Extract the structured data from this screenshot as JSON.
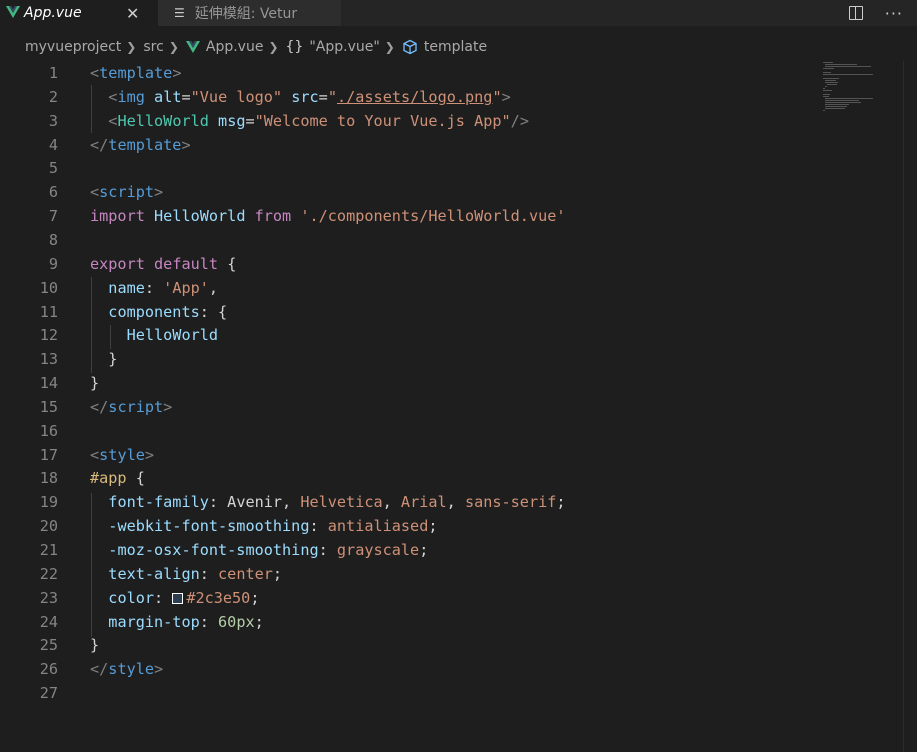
{
  "tabs": {
    "active": {
      "label": "App.vue",
      "close": "✕"
    },
    "inactive": {
      "label": "延伸模組: Vetur"
    }
  },
  "breadcrumb": {
    "items": [
      "myvueproject",
      "src",
      "App.vue",
      "\"App.vue\"",
      "template"
    ],
    "braces": "{}"
  },
  "actions": {
    "more": "···"
  },
  "colors": {
    "vue_green": "#41b883",
    "vue_dark": "#34495e",
    "swatch": "#2c3e50"
  },
  "editor": {
    "lines": [
      {
        "n": "1",
        "tokens": [
          [
            "t-tag",
            "<"
          ],
          [
            "t-tagname",
            "template"
          ],
          [
            "t-tag",
            ">"
          ]
        ]
      },
      {
        "n": "2",
        "tokens": [
          [
            "t-plain",
            "  "
          ],
          [
            "t-tag",
            "<"
          ],
          [
            "t-tagname",
            "img"
          ],
          [
            "t-plain",
            " "
          ],
          [
            "t-attr",
            "alt"
          ],
          [
            "t-plain",
            "="
          ],
          [
            "t-str",
            "\"Vue logo\""
          ],
          [
            "t-plain",
            " "
          ],
          [
            "t-attr",
            "src"
          ],
          [
            "t-plain",
            "="
          ],
          [
            "t-str",
            "\""
          ],
          [
            "t-str t-link",
            "./assets/logo.png"
          ],
          [
            "t-str",
            "\""
          ],
          [
            "t-tag",
            ">"
          ]
        ]
      },
      {
        "n": "3",
        "tokens": [
          [
            "t-plain",
            "  "
          ],
          [
            "t-tag",
            "<"
          ],
          [
            "t-comp",
            "HelloWorld"
          ],
          [
            "t-plain",
            " "
          ],
          [
            "t-attr",
            "msg"
          ],
          [
            "t-plain",
            "="
          ],
          [
            "t-str",
            "\"Welcome to Your Vue.js App\""
          ],
          [
            "t-tag",
            "/>"
          ]
        ]
      },
      {
        "n": "4",
        "tokens": [
          [
            "t-tag",
            "</"
          ],
          [
            "t-tagname",
            "template"
          ],
          [
            "t-tag",
            ">"
          ]
        ]
      },
      {
        "n": "5",
        "tokens": []
      },
      {
        "n": "6",
        "tokens": [
          [
            "t-tag",
            "<"
          ],
          [
            "t-tagname",
            "script"
          ],
          [
            "t-tag",
            ">"
          ]
        ]
      },
      {
        "n": "7",
        "tokens": [
          [
            "t-kw",
            "import"
          ],
          [
            "t-plain",
            " "
          ],
          [
            "t-id",
            "HelloWorld"
          ],
          [
            "t-plain",
            " "
          ],
          [
            "t-kw",
            "from"
          ],
          [
            "t-plain",
            " "
          ],
          [
            "t-str",
            "'./components/HelloWorld.vue'"
          ]
        ]
      },
      {
        "n": "8",
        "tokens": []
      },
      {
        "n": "9",
        "tokens": [
          [
            "t-kw",
            "export"
          ],
          [
            "t-plain",
            " "
          ],
          [
            "t-kw",
            "default"
          ],
          [
            "t-plain",
            " {"
          ]
        ]
      },
      {
        "n": "10",
        "tokens": [
          [
            "t-plain",
            "  "
          ],
          [
            "t-id",
            "name"
          ],
          [
            "t-plain",
            ": "
          ],
          [
            "t-str",
            "'App'"
          ],
          [
            "t-plain",
            ","
          ]
        ]
      },
      {
        "n": "11",
        "tokens": [
          [
            "t-plain",
            "  "
          ],
          [
            "t-id",
            "components"
          ],
          [
            "t-plain",
            ": {"
          ]
        ]
      },
      {
        "n": "12",
        "tokens": [
          [
            "t-plain",
            "    "
          ],
          [
            "t-id",
            "HelloWorld"
          ]
        ]
      },
      {
        "n": "13",
        "tokens": [
          [
            "t-plain",
            "  }"
          ]
        ]
      },
      {
        "n": "14",
        "tokens": [
          [
            "t-plain",
            "}"
          ]
        ]
      },
      {
        "n": "15",
        "tokens": [
          [
            "t-tag",
            "</"
          ],
          [
            "t-tagname",
            "script"
          ],
          [
            "t-tag",
            ">"
          ]
        ]
      },
      {
        "n": "16",
        "tokens": []
      },
      {
        "n": "17",
        "tokens": [
          [
            "t-tag",
            "<"
          ],
          [
            "t-tagname",
            "style"
          ],
          [
            "t-tag",
            ">"
          ]
        ]
      },
      {
        "n": "18",
        "tokens": [
          [
            "t-sel",
            "#app"
          ],
          [
            "t-plain",
            " {"
          ]
        ]
      },
      {
        "n": "19",
        "tokens": [
          [
            "t-plain",
            "  "
          ],
          [
            "t-id",
            "font-family"
          ],
          [
            "t-plain",
            ": Avenir, "
          ],
          [
            "t-str",
            "Helvetica"
          ],
          [
            "t-plain",
            ", "
          ],
          [
            "t-str",
            "Arial"
          ],
          [
            "t-plain",
            ", "
          ],
          [
            "t-str",
            "sans-serif"
          ],
          [
            "t-plain",
            ";"
          ]
        ]
      },
      {
        "n": "20",
        "tokens": [
          [
            "t-plain",
            "  "
          ],
          [
            "t-id",
            "-webkit-font-smoothing"
          ],
          [
            "t-plain",
            ": "
          ],
          [
            "t-str",
            "antialiased"
          ],
          [
            "t-plain",
            ";"
          ]
        ]
      },
      {
        "n": "21",
        "tokens": [
          [
            "t-plain",
            "  "
          ],
          [
            "t-id",
            "-moz-osx-font-smoothing"
          ],
          [
            "t-plain",
            ": "
          ],
          [
            "t-str",
            "grayscale"
          ],
          [
            "t-plain",
            ";"
          ]
        ]
      },
      {
        "n": "22",
        "tokens": [
          [
            "t-plain",
            "  "
          ],
          [
            "t-id",
            "text-align"
          ],
          [
            "t-plain",
            ": "
          ],
          [
            "t-str",
            "center"
          ],
          [
            "t-plain",
            ";"
          ]
        ]
      },
      {
        "n": "23",
        "tokens": [
          [
            "t-plain",
            "  "
          ],
          [
            "t-id",
            "color"
          ],
          [
            "t-plain",
            ": "
          ],
          [
            "swatch",
            ""
          ],
          [
            "t-str",
            "#2c3e50"
          ],
          [
            "t-plain",
            ";"
          ]
        ]
      },
      {
        "n": "24",
        "tokens": [
          [
            "t-plain",
            "  "
          ],
          [
            "t-id",
            "margin-top"
          ],
          [
            "t-plain",
            ": "
          ],
          [
            "t-num",
            "60px"
          ],
          [
            "t-plain",
            ";"
          ]
        ]
      },
      {
        "n": "25",
        "tokens": [
          [
            "t-plain",
            "}"
          ]
        ]
      },
      {
        "n": "26",
        "tokens": [
          [
            "t-tag",
            "</"
          ],
          [
            "t-tagname",
            "style"
          ],
          [
            "t-tag",
            ">"
          ]
        ]
      },
      {
        "n": "27",
        "tokens": []
      }
    ]
  }
}
